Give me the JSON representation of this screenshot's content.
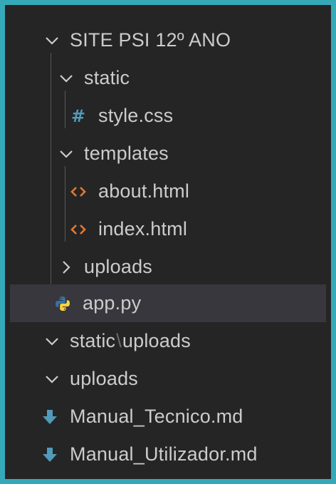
{
  "explorer": {
    "project": {
      "label": "SITE PSI 12º ANO",
      "state": "expanded",
      "icon": "chevron-down-icon"
    },
    "items": [
      {
        "label": "static",
        "kind": "folder",
        "state": "expanded",
        "icon": "chevron-down-icon"
      },
      {
        "label": "style.css",
        "kind": "file",
        "icon": "css-hash-icon",
        "icon_glyph": "#"
      },
      {
        "label": "templates",
        "kind": "folder",
        "state": "expanded",
        "icon": "chevron-down-icon"
      },
      {
        "label": "about.html",
        "kind": "file",
        "icon": "html-icon"
      },
      {
        "label": "index.html",
        "kind": "file",
        "icon": "html-icon"
      },
      {
        "label": "uploads",
        "kind": "folder",
        "state": "collapsed",
        "icon": "chevron-right-icon"
      },
      {
        "label": "app.py",
        "kind": "file",
        "icon": "python-icon",
        "selected": true
      }
    ],
    "root_items": [
      {
        "label_part1": "static",
        "label_sep": "\\",
        "label_part2": "uploads",
        "kind": "folder",
        "state": "expanded",
        "icon": "chevron-down-icon"
      },
      {
        "label": "uploads",
        "kind": "folder",
        "state": "expanded",
        "icon": "chevron-down-icon"
      },
      {
        "label": "Manual_Tecnico.md",
        "kind": "file",
        "icon": "markdown-download-icon"
      },
      {
        "label": "Manual_Utilizador.md",
        "kind": "file",
        "icon": "markdown-download-icon"
      }
    ]
  },
  "colors": {
    "frame_border": "#35a9b8",
    "background": "#252526",
    "selected_row": "#37373d",
    "text": "#cccccc",
    "css_icon": "#519aba",
    "html_icon": "#e37933",
    "python_icon_blue": "#3572a5",
    "python_icon_yellow": "#ffd43b",
    "markdown_icon": "#519aba"
  }
}
